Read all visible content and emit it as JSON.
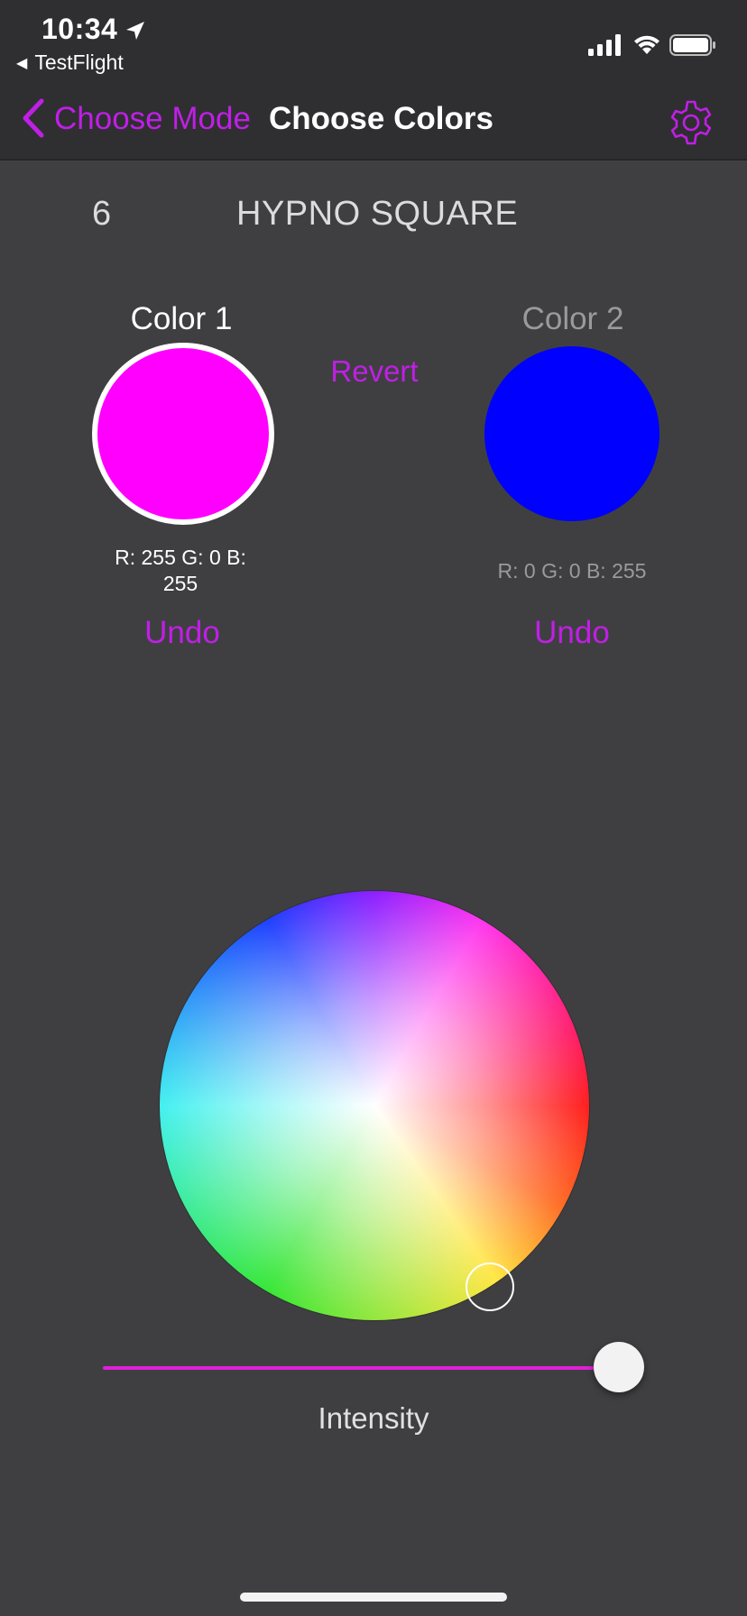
{
  "status_bar": {
    "time": "10:34",
    "back_app_label": "TestFlight",
    "icons": [
      "location-arrow-icon",
      "cellular-signal-icon",
      "wifi-icon",
      "battery-icon"
    ]
  },
  "nav": {
    "back_label": "Choose Mode",
    "title": "Choose Colors",
    "accent_color": "#c01fe6",
    "settings_icon": "gear-icon"
  },
  "mode": {
    "number": "6",
    "name": "HYPNO SQUARE"
  },
  "colors": {
    "revert_label": "Revert",
    "color1": {
      "label": "Color 1",
      "swatch_hex": "#ff00ff",
      "rgb_text": "R: 255 G: 0 B: 255",
      "undo_label": "Undo",
      "selected": true
    },
    "color2": {
      "label": "Color 2",
      "swatch_hex": "#0000ff",
      "rgb_text": "R: 0 G: 0 B: 255",
      "undo_label": "Undo",
      "selected": false
    }
  },
  "picker": {
    "type": "color-wheel",
    "intensity_label": "Intensity",
    "intensity_value": 1.0
  }
}
